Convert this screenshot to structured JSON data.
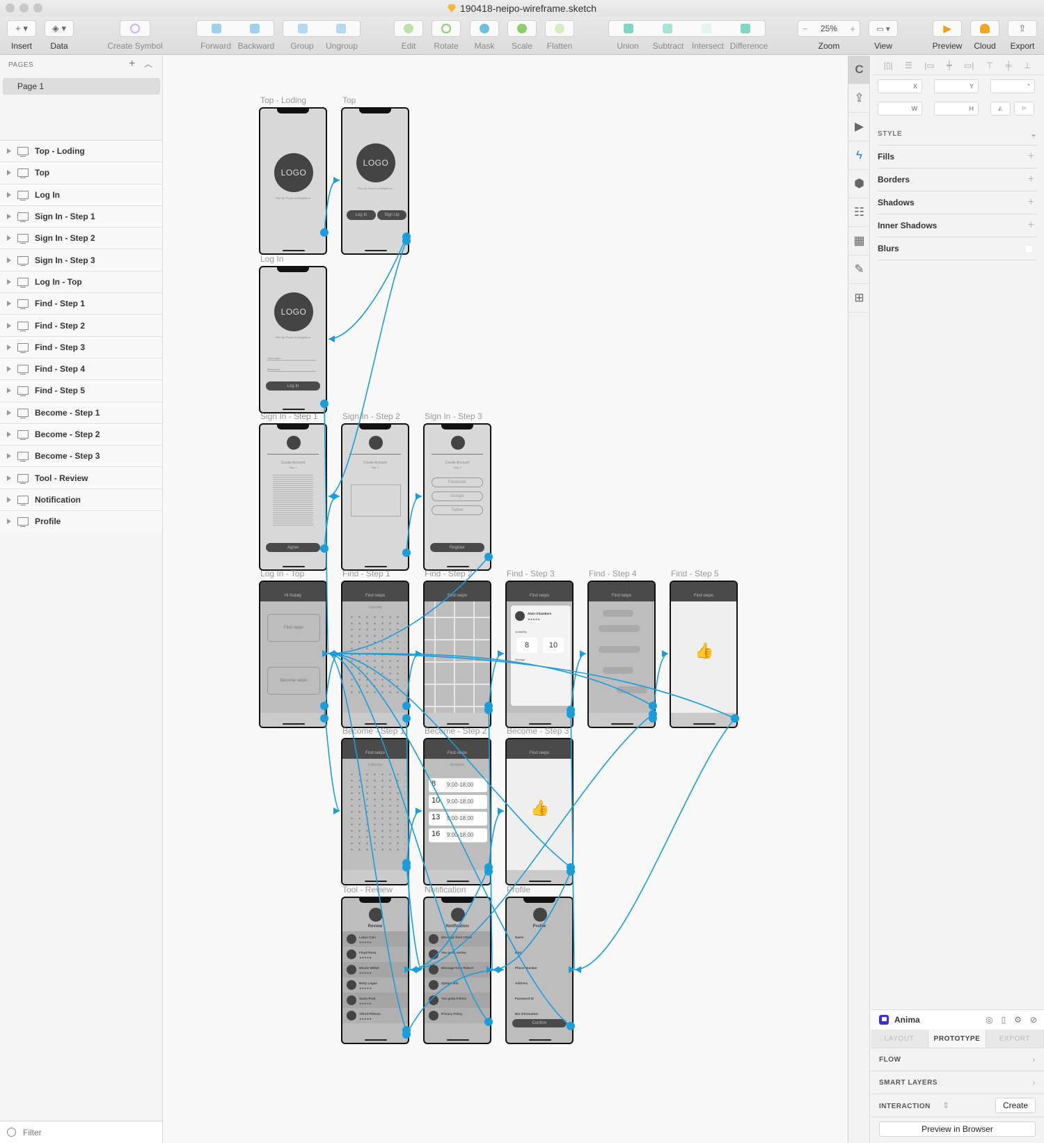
{
  "window": {
    "title": "190418-neipo-wireframe.sketch"
  },
  "toolbar": {
    "items": [
      {
        "label": "Insert",
        "icon": "plus-icon"
      },
      {
        "label": "Data",
        "icon": "layers-icon"
      },
      {
        "label": "Create Symbol",
        "icon": "symbol-icon"
      },
      {
        "label": "Forward",
        "icon": "forward-icon"
      },
      {
        "label": "Backward",
        "icon": "backward-icon"
      },
      {
        "label": "Group",
        "icon": "group-icon"
      },
      {
        "label": "Ungroup",
        "icon": "ungroup-icon"
      },
      {
        "label": "Edit",
        "icon": "edit-icon"
      },
      {
        "label": "Rotate",
        "icon": "rotate-icon"
      },
      {
        "label": "Mask",
        "icon": "mask-icon"
      },
      {
        "label": "Scale",
        "icon": "scale-icon"
      },
      {
        "label": "Flatten",
        "icon": "flatten-icon"
      },
      {
        "label": "Union",
        "icon": "union-icon"
      },
      {
        "label": "Subtract",
        "icon": "subtract-icon"
      },
      {
        "label": "Intersect",
        "icon": "intersect-icon"
      },
      {
        "label": "Difference",
        "icon": "difference-icon"
      },
      {
        "label": "Zoom",
        "icon": "zoom-icon"
      },
      {
        "label": "View",
        "icon": "view-icon"
      },
      {
        "label": "Preview",
        "icon": "play-icon"
      },
      {
        "label": "Cloud",
        "icon": "cloud-icon"
      },
      {
        "label": "Export",
        "icon": "share-icon"
      }
    ],
    "zoom_value": "25%",
    "zoom_minus": "−",
    "zoom_plus": "+"
  },
  "pages": {
    "header": "PAGES",
    "add": "+",
    "collapse": "^",
    "current": "Page 1"
  },
  "layers": [
    "Top - Loding",
    "Top",
    "Log In",
    "Sign In - Step 1",
    "Sign In - Step 2",
    "Sign In - Step 3",
    "Log In - Top",
    "Find - Step 1",
    "Find - Step 2",
    "Find - Step 3",
    "Find - Step 4",
    "Find - Step 5",
    "Become - Step 1",
    "Become - Step 2",
    "Become - Step 3",
    "Tool - Review",
    "Notification",
    "Profile"
  ],
  "filter": {
    "label": "Filter"
  },
  "artboards": {
    "top_loding": {
      "title": "Top - Loding",
      "logo": "LOGO",
      "tagline": "Pick Up Parcel at Neighbour"
    },
    "top": {
      "title": "Top",
      "logo": "LOGO",
      "tagline": "Pick Up Parcel at Neighbour",
      "login": "Log In",
      "signup": "Sign Up"
    },
    "login": {
      "title": "Log In",
      "logo": "LOGO",
      "tagline": "Pick Up Parcel at Neighbour",
      "user": "User name",
      "password": "Password",
      "button": "Log In"
    },
    "signin1": {
      "title": "Sign In - Step 1",
      "heading": "Create Account",
      "sub": "Step 1",
      "button": "Agree"
    },
    "signin2": {
      "title": "Sign In - Step 2",
      "heading": "Create Account",
      "sub": "Step 2"
    },
    "signin3": {
      "title": "Sign In - Step 3",
      "heading": "Create Account",
      "sub": "Step 3",
      "options": [
        "Facebook",
        "Google",
        "Twitter"
      ],
      "button": "Register"
    },
    "login_top": {
      "title": "Log In - Top",
      "header": "Hi Nataly",
      "card1": "Find neipo",
      "card2": "Become neipo"
    },
    "find1": {
      "title": "Find - Step 1",
      "header": "Find neipo",
      "sub": "Calendar"
    },
    "find2": {
      "title": "Find - Step 2",
      "header": "Find neipo"
    },
    "find3": {
      "title": "Find - Step 3",
      "header": "Find neipo",
      "name": "Alvin Chambers",
      "stars": "★★★★★",
      "availability": "Availability",
      "day1": "8",
      "day2": "10",
      "message_label": "Message"
    },
    "find4": {
      "title": "Find - Step 4",
      "header": "Find neipo"
    },
    "find5": {
      "title": "Find - Step 5",
      "header": "Find neipo"
    },
    "become1": {
      "title": "Become - Step 1",
      "header": "Find neipo",
      "sub": "Calendar"
    },
    "become2": {
      "title": "Become - Step 2",
      "header": "Find neipo",
      "sub": "Available",
      "slots": [
        {
          "day": "8",
          "time": "9:00-18:00"
        },
        {
          "day": "10",
          "time": "9:00-18:00"
        },
        {
          "day": "13",
          "time": "9:00-18:00"
        },
        {
          "day": "16",
          "time": "9:00-18:00"
        }
      ]
    },
    "become3": {
      "title": "Become - Step 3",
      "header": "Find neipo"
    },
    "review": {
      "title": "Tool - Review",
      "heading": "Review",
      "people": [
        "Lukas Cain",
        "Floyd Ross",
        "Minnie Weber",
        "Betty Logan",
        "Susie Pratt",
        "Alfred Pittman"
      ],
      "stars": "★★★★★"
    },
    "notification": {
      "title": "Notification",
      "heading": "Notification",
      "items": [
        "Message from Chloe",
        "You gotta review",
        "Message from Robert",
        "Update info",
        "You gotta Follow",
        "Privacy Policy"
      ]
    },
    "profile": {
      "title": "Profile",
      "heading": "Profile",
      "fields": [
        "Name",
        "Mail",
        "Phone Number",
        "Address",
        "Password ID",
        "Bio information"
      ],
      "button": "Confirm"
    }
  },
  "prototype_links": [
    [
      "top_loding",
      "top"
    ],
    [
      "top",
      "login"
    ],
    [
      "top",
      "signin1"
    ],
    [
      "login",
      "login_top"
    ],
    [
      "signin1",
      "signin2"
    ],
    [
      "signin2",
      "signin3"
    ],
    [
      "signin3",
      "login_top"
    ],
    [
      "login_top",
      "find1"
    ],
    [
      "find1",
      "find2"
    ],
    [
      "find2",
      "find3"
    ],
    [
      "find3",
      "find4"
    ],
    [
      "find4",
      "find5"
    ],
    [
      "login_top",
      "become1"
    ],
    [
      "become1",
      "become2"
    ],
    [
      "become2",
      "become3"
    ],
    [
      "find1",
      "review"
    ],
    [
      "find2",
      "notification"
    ],
    [
      "find3",
      "profile"
    ],
    [
      "find4",
      "review"
    ],
    [
      "find5",
      "profile"
    ],
    [
      "become1",
      "notification"
    ],
    [
      "become2",
      "review"
    ],
    [
      "become3",
      "notification"
    ],
    [
      "review",
      "profile"
    ],
    [
      "notification",
      "login_top"
    ],
    [
      "profile",
      "login_top"
    ],
    [
      "review",
      "login_top"
    ],
    [
      "find5",
      "login_top"
    ],
    [
      "find4",
      "login_top"
    ],
    [
      "become3",
      "login_top"
    ]
  ],
  "link_color": "#1a9ddb",
  "inspector": {
    "fields": {
      "x": "X",
      "y": "Y",
      "rotation": "°",
      "w": "W",
      "h": "H"
    },
    "style_header": "STYLE",
    "sections": [
      "Fills",
      "Borders",
      "Shadows",
      "Inner Shadows",
      "Blurs"
    ]
  },
  "anima": {
    "title": "Anima",
    "tabs": [
      "LAYOUT",
      "PROTOTYPE",
      "EXPORT"
    ],
    "active_tab": "PROTOTYPE",
    "rows": [
      "FLOW",
      "SMART LAYERS"
    ],
    "interaction_label": "INTERACTION",
    "create_button": "Create",
    "preview_button": "Preview in Browser"
  }
}
